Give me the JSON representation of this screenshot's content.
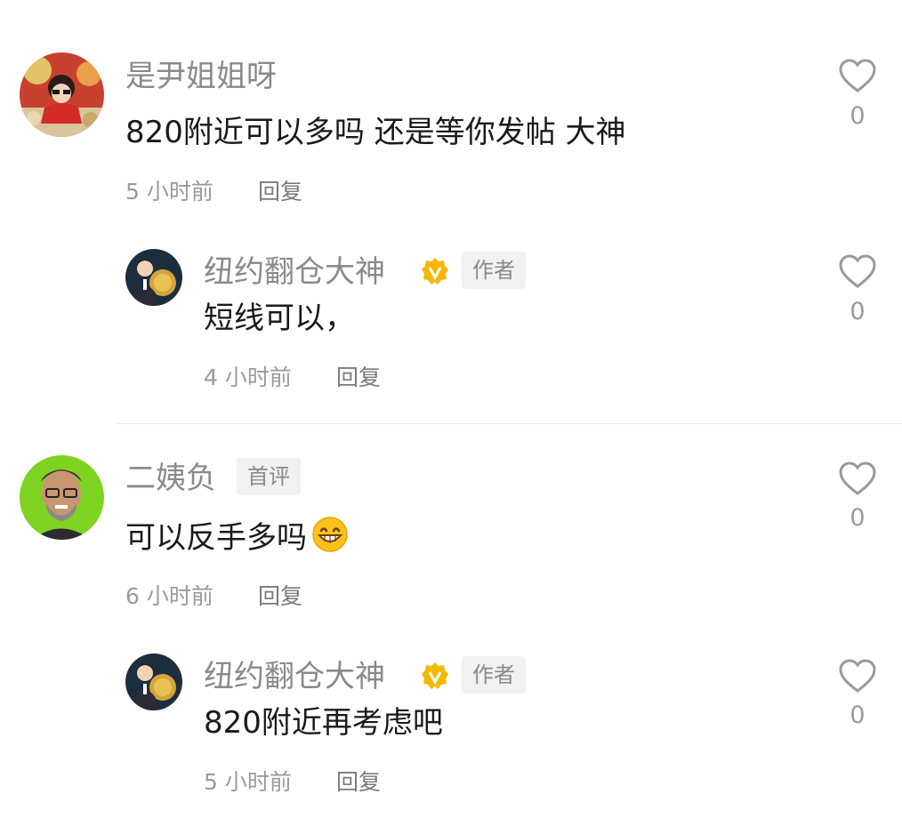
{
  "comments": [
    {
      "user": "是尹姐姐呀",
      "text": "820附近可以多吗 还是等你发帖 大神",
      "time": "5 小时前",
      "reply_label": "回复",
      "likes": "0"
    },
    {
      "user": "纽约翻仓大神",
      "tag": "作者",
      "text": "短线可以，",
      "time": "4 小时前",
      "reply_label": "回复",
      "likes": "0"
    },
    {
      "user": "二姨负",
      "tag": "首评",
      "text": "可以反手多吗",
      "time": "6 小时前",
      "reply_label": "回复",
      "likes": "0"
    },
    {
      "user": "纽约翻仓大神",
      "tag": "作者",
      "text": "820附近再考虑吧",
      "time": "5 小时前",
      "reply_label": "回复",
      "likes": "0"
    }
  ],
  "icons": {
    "like": "heart-outline-icon",
    "verified": "verified-badge-icon",
    "emoji": "grinning-face-emoji"
  },
  "colors": {
    "verified": "#f5b800",
    "name": "#8a8a8a",
    "text": "#1a1a1a",
    "meta": "#9a9a9a"
  }
}
